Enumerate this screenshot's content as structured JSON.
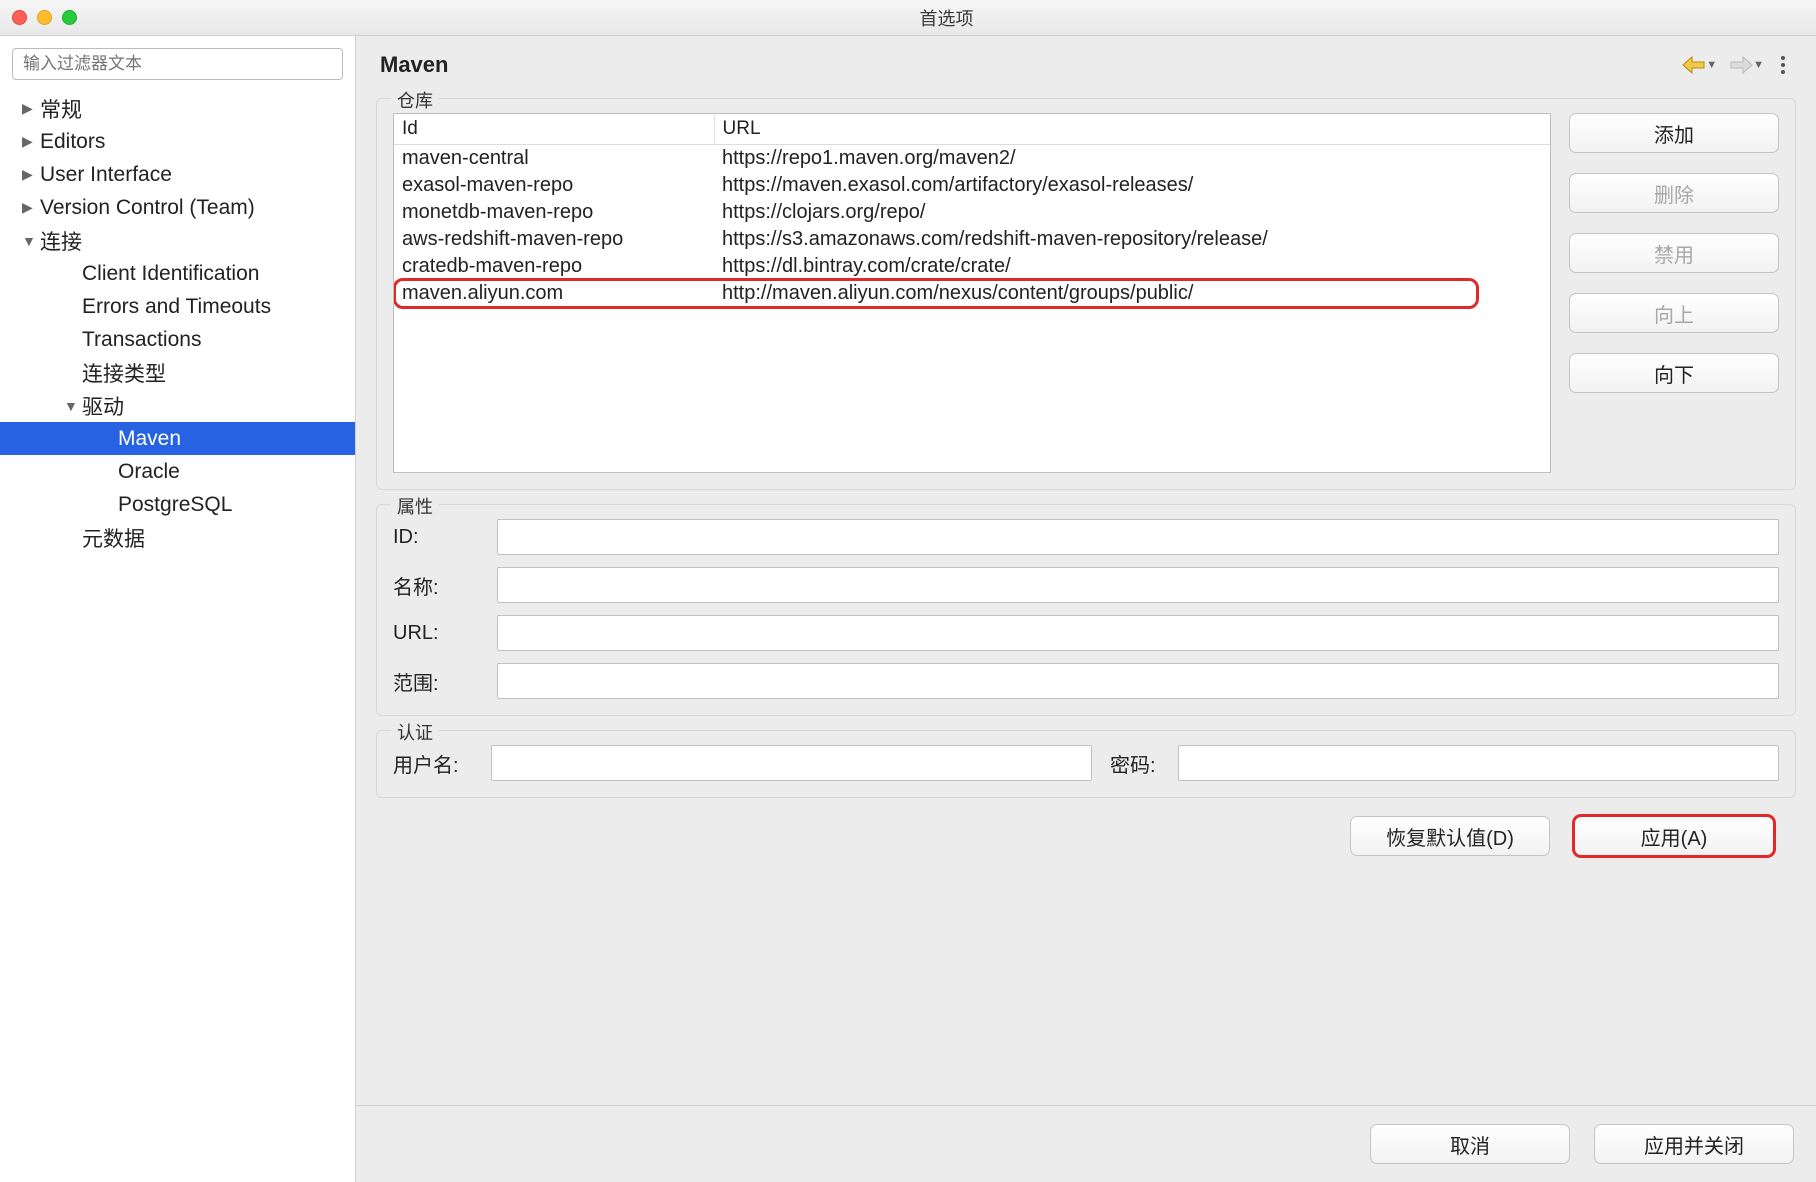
{
  "window": {
    "title": "首选项"
  },
  "sidebar": {
    "filter_placeholder": "输入过滤器文本",
    "items": [
      {
        "label": "常规",
        "level": 0,
        "arrow": "▶",
        "selected": false
      },
      {
        "label": "Editors",
        "level": 0,
        "arrow": "▶",
        "selected": false
      },
      {
        "label": "User Interface",
        "level": 0,
        "arrow": "▶",
        "selected": false
      },
      {
        "label": "Version Control (Team)",
        "level": 0,
        "arrow": "▶",
        "selected": false
      },
      {
        "label": "连接",
        "level": 0,
        "arrow": "▼",
        "selected": false
      },
      {
        "label": "Client Identification",
        "level": 1,
        "arrow": "",
        "selected": false
      },
      {
        "label": "Errors and Timeouts",
        "level": 1,
        "arrow": "",
        "selected": false
      },
      {
        "label": "Transactions",
        "level": 1,
        "arrow": "",
        "selected": false
      },
      {
        "label": "连接类型",
        "level": 1,
        "arrow": "",
        "selected": false
      },
      {
        "label": "驱动",
        "level": 1,
        "arrow": "▼",
        "selected": false
      },
      {
        "label": "Maven",
        "level": 2,
        "arrow": "",
        "selected": true
      },
      {
        "label": "Oracle",
        "level": 2,
        "arrow": "",
        "selected": false
      },
      {
        "label": "PostgreSQL",
        "level": 2,
        "arrow": "",
        "selected": false
      },
      {
        "label": "元数据",
        "level": 1,
        "arrow": "",
        "selected": false
      }
    ]
  },
  "page": {
    "title": "Maven"
  },
  "repos": {
    "group_label": "仓库",
    "col_id": "Id",
    "col_url": "URL",
    "rows": [
      {
        "id": "maven-central",
        "url": "https://repo1.maven.org/maven2/",
        "hl": false
      },
      {
        "id": "exasol-maven-repo",
        "url": "https://maven.exasol.com/artifactory/exasol-releases/",
        "hl": false
      },
      {
        "id": "monetdb-maven-repo",
        "url": "https://clojars.org/repo/",
        "hl": false
      },
      {
        "id": "aws-redshift-maven-repo",
        "url": "https://s3.amazonaws.com/redshift-maven-repository/release/",
        "hl": false
      },
      {
        "id": "cratedb-maven-repo",
        "url": "https://dl.bintray.com/crate/crate/",
        "hl": false
      },
      {
        "id": "maven.aliyun.com",
        "url": "http://maven.aliyun.com/nexus/content/groups/public/",
        "hl": true
      }
    ],
    "buttons": {
      "add": "添加",
      "delete": "删除",
      "disable": "禁用",
      "up": "向上",
      "down": "向下"
    }
  },
  "props": {
    "group_label": "属性",
    "id_label": "ID:",
    "name_label": "名称:",
    "url_label": "URL:",
    "scope_label": "范围:",
    "id_value": "",
    "name_value": "",
    "url_value": "",
    "scope_value": ""
  },
  "auth": {
    "group_label": "认证",
    "user_label": "用户名:",
    "pass_label": "密码:",
    "user_value": "",
    "pass_value": ""
  },
  "footer": {
    "restore": "恢复默认值(D)",
    "apply": "应用(A)",
    "cancel": "取消",
    "apply_close": "应用并关闭"
  }
}
